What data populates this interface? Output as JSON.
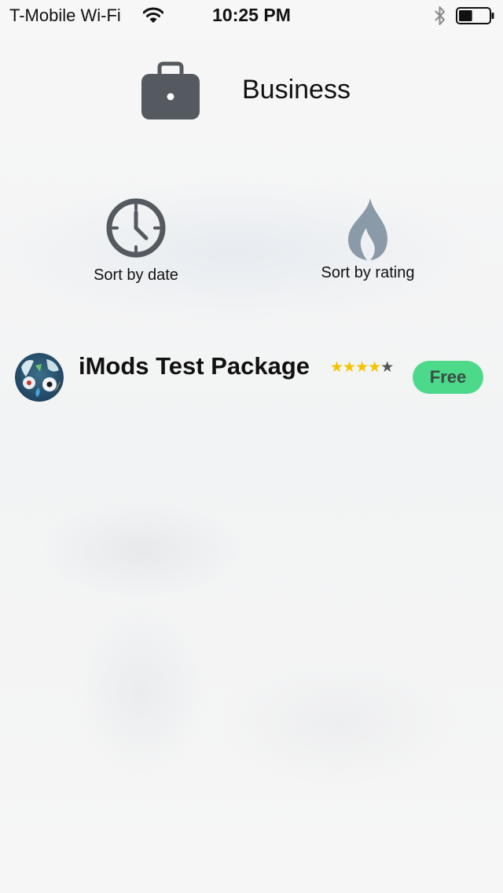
{
  "status_bar": {
    "carrier": "T-Mobile Wi-Fi",
    "time": "10:25 PM",
    "battery_level": 0.45,
    "icons": [
      "wifi-icon",
      "bluetooth-icon",
      "battery-icon"
    ]
  },
  "category": {
    "title": "Business",
    "icon": "briefcase-icon"
  },
  "sort_options": [
    {
      "label": "Sort by date",
      "icon": "clock-icon"
    },
    {
      "label": "Sort by rating",
      "icon": "flame-icon"
    }
  ],
  "packages": [
    {
      "name": "iMods Test Package",
      "rating": 4,
      "rating_max": 5,
      "price": "Free",
      "icon": "package-avatar"
    }
  ],
  "colors": {
    "price_button": "#4cd98a",
    "star_filled": "#f5c400",
    "star_empty": "#555555",
    "icon_gray": "#555a60",
    "flame": "#8a9aa8"
  }
}
